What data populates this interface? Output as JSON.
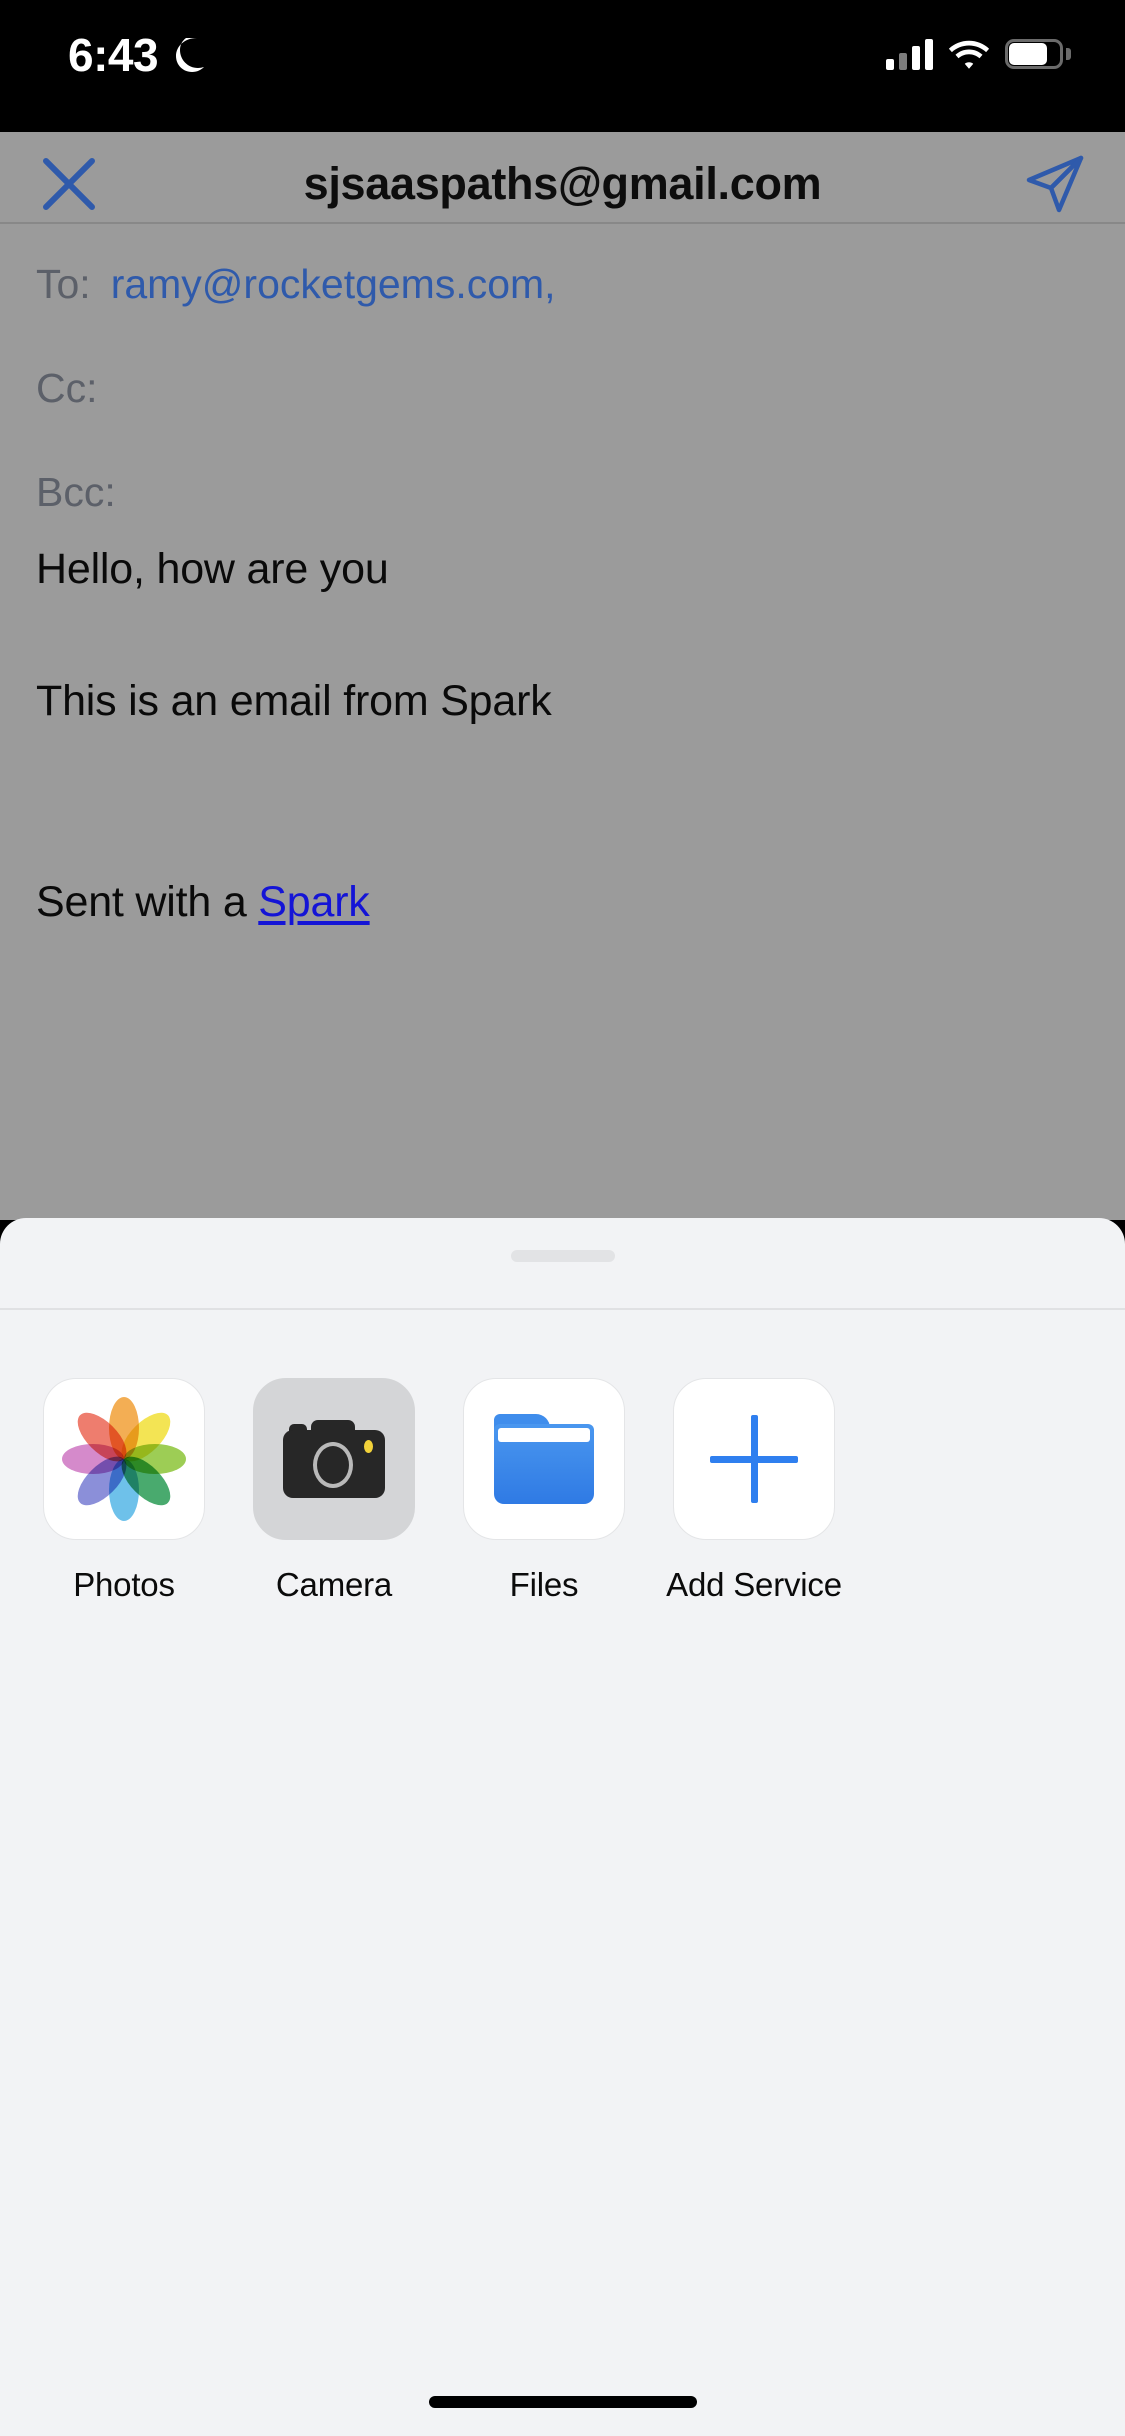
{
  "status_bar": {
    "time": "6:43",
    "dnd_icon": "moon-icon",
    "cellular_icon": "cellular-signal-icon",
    "wifi_icon": "wifi-icon",
    "battery_icon": "battery-icon"
  },
  "compose": {
    "title": "sjsaaspaths@gmail.com",
    "close_icon": "close-icon",
    "send_icon": "send-icon",
    "fields": [
      {
        "label": "To:",
        "value": "ramy@rocketgems.com,"
      },
      {
        "label": "Cc:",
        "value": ""
      },
      {
        "label": "Bcc:",
        "value": ""
      }
    ],
    "subject": "Hello, how are you",
    "paragraph": "This is an email from Spark",
    "signature_prefix": "Sent with a ",
    "signature_link": "Spark"
  },
  "attachment_sheet": {
    "items": [
      {
        "label": "Photos",
        "icon": "photos-icon"
      },
      {
        "label": "Camera",
        "icon": "camera-icon"
      },
      {
        "label": "Files",
        "icon": "files-icon"
      },
      {
        "label": "Add Service",
        "icon": "plus-icon"
      }
    ]
  },
  "colors": {
    "accent_blue": "#2f5aab",
    "link_blue": "#1414d6",
    "sheet_gray": "#9b9b9b",
    "panel_bg": "#f2f3f5",
    "tile_white": "#ffffff",
    "tile_gray": "#d4d5d7"
  }
}
